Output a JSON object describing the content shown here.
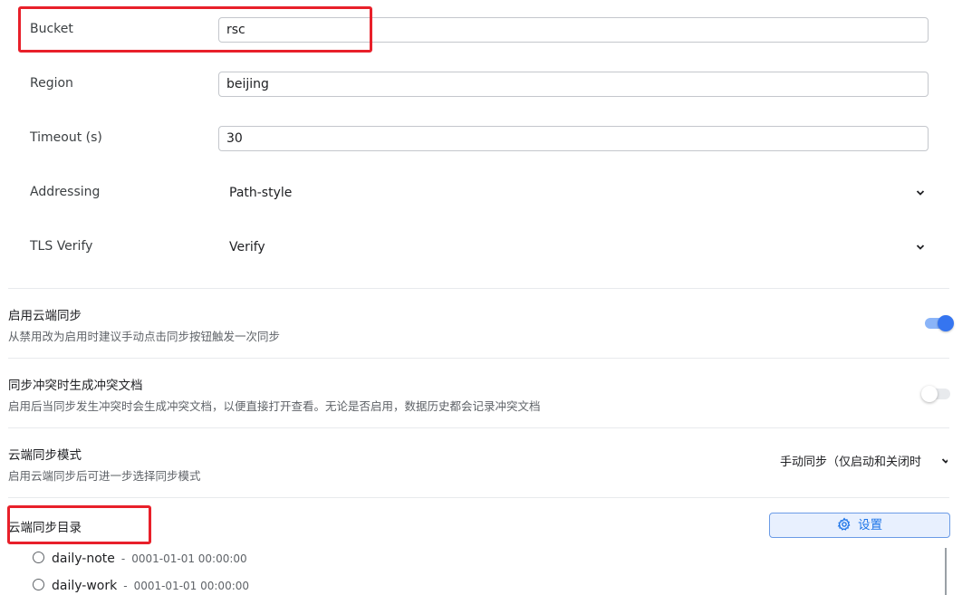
{
  "fields": {
    "bucket": {
      "label": "Bucket",
      "value": "rsc"
    },
    "region": {
      "label": "Region",
      "value": "beijing"
    },
    "timeout": {
      "label": "Timeout (s)",
      "value": "30"
    },
    "addressing": {
      "label": "Addressing",
      "selected": "Path-style"
    },
    "tls_verify": {
      "label": "TLS Verify",
      "selected": "Verify"
    }
  },
  "sync": {
    "enable": {
      "title": "启用云端同步",
      "desc": "从禁用改为启用时建议手动点击同步按钮触发一次同步",
      "on": true
    },
    "conflict": {
      "title": "同步冲突时生成冲突文档",
      "desc": "启用后当同步发生冲突时会生成冲突文档，以便直接打开查看。无论是否启用，数据历史都会记录冲突文档",
      "on": false
    },
    "mode": {
      "title": "云端同步模式",
      "desc": "启用云端同步后可进一步选择同步模式",
      "selected": "手动同步（仅启动和关闭时"
    }
  },
  "directory": {
    "title": "云端同步目录",
    "settings_label": "设置",
    "items": [
      {
        "name": "daily-note",
        "sep": "-",
        "time": "0001-01-01 00:00:00"
      },
      {
        "name": "daily-work",
        "sep": "-",
        "time": "0001-01-01 00:00:00"
      }
    ]
  },
  "colors": {
    "accent": "#3575f0",
    "highlight": "#e8202a"
  }
}
